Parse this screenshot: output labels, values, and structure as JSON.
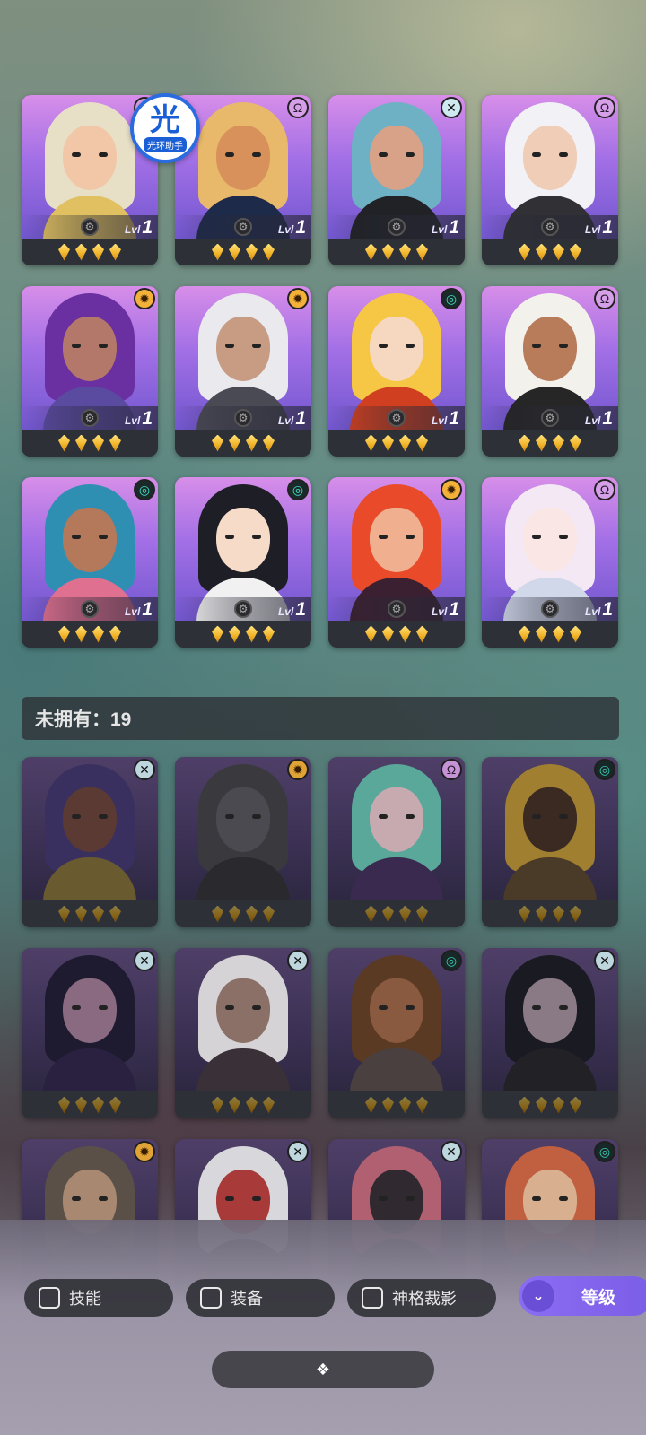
{
  "halo_badge": {
    "glyph": "光",
    "label": "光环助手"
  },
  "owned_heroes": [
    {
      "class_icon": "rose",
      "level_label": "Lvl",
      "level": "1",
      "stars": 4,
      "hair": "#e8dfc7",
      "skin": "#f1c7a8",
      "cloth": "#e0c060"
    },
    {
      "class_icon": "rose",
      "level_label": "Lvl",
      "level": "1",
      "stars": 4,
      "hair": "#e8b96a",
      "skin": "#d9915c",
      "cloth": "#1e2a4a"
    },
    {
      "class_icon": "cross",
      "level_label": "Lvl",
      "level": "1",
      "stars": 4,
      "hair": "#6fb1c4",
      "skin": "#d7a287",
      "cloth": "#202226"
    },
    {
      "class_icon": "rose",
      "level_label": "Lvl",
      "level": "1",
      "stars": 4,
      "hair": "#f1f1f6",
      "skin": "#efcdb7",
      "cloth": "#303035"
    },
    {
      "class_icon": "sun",
      "level_label": "Lvl",
      "level": "1",
      "stars": 4,
      "hair": "#6a2fa0",
      "skin": "#b4786a",
      "cloth": "#5a4aa0"
    },
    {
      "class_icon": "sun",
      "level_label": "Lvl",
      "level": "1",
      "stars": 4,
      "hair": "#e9e9ee",
      "skin": "#c79c83",
      "cloth": "#4a4a55"
    },
    {
      "class_icon": "swirl",
      "level_label": "Lvl",
      "level": "1",
      "stars": 4,
      "hair": "#f6c745",
      "skin": "#f6d8c0",
      "cloth": "#d04020"
    },
    {
      "class_icon": "rose",
      "level_label": "Lvl",
      "level": "1",
      "stars": 4,
      "hair": "#f3f1ec",
      "skin": "#b87c5a",
      "cloth": "#262626"
    },
    {
      "class_icon": "swirl",
      "level_label": "Lvl",
      "level": "1",
      "stars": 4,
      "hair": "#2f8fb2",
      "skin": "#b4785a",
      "cloth": "#e07090"
    },
    {
      "class_icon": "swirl",
      "level_label": "Lvl",
      "level": "1",
      "stars": 4,
      "hair": "#1e1e26",
      "skin": "#f6dcc8",
      "cloth": "#f1f1f1"
    },
    {
      "class_icon": "sun",
      "level_label": "Lvl",
      "level": "1",
      "stars": 4,
      "hair": "#e84a2a",
      "skin": "#f0b090",
      "cloth": "#3a2030"
    },
    {
      "class_icon": "rose",
      "level_label": "Lvl",
      "level": "1",
      "stars": 4,
      "hair": "#f3e8f4",
      "skin": "#fbe6e6",
      "cloth": "#d0d8ea"
    }
  ],
  "unowned_section": {
    "label": "未拥有：19"
  },
  "unowned_heroes": [
    {
      "class_icon": "cross",
      "stars": 4,
      "hair": "#3a3060",
      "skin": "#5a3a32",
      "cloth": "#6a5a30"
    },
    {
      "class_icon": "sun",
      "stars": 4,
      "hair": "#3a3a3e",
      "skin": "#4a4a50",
      "cloth": "#2a2a2e"
    },
    {
      "class_icon": "rose",
      "stars": 4,
      "hair": "#5aa89a",
      "skin": "#c7a9b0",
      "cloth": "#3a2a50"
    },
    {
      "class_icon": "swirl",
      "stars": 4,
      "hair": "#a08030",
      "skin": "#3a2a22",
      "cloth": "#4a3a28"
    },
    {
      "class_icon": "cross",
      "stars": 4,
      "hair": "#1e1a30",
      "skin": "#8a6a80",
      "cloth": "#2a2040"
    },
    {
      "class_icon": "cross",
      "stars": 4,
      "hair": "#d6d3d6",
      "skin": "#8a7066",
      "cloth": "#3a3038"
    },
    {
      "class_icon": "swirl",
      "stars": 4,
      "hair": "#5a3a22",
      "skin": "#8a5a40",
      "cloth": "#4a4040"
    },
    {
      "class_icon": "cross",
      "stars": 4,
      "hair": "#1a1a22",
      "skin": "#8a7a86",
      "cloth": "#222226"
    },
    {
      "class_icon": "sun",
      "stars": 4,
      "hair": "#5a5048",
      "skin": "#a88870",
      "cloth": "#3a3a40"
    },
    {
      "class_icon": "cross",
      "stars": 4,
      "hair": "#d8d8dc",
      "skin": "#a83a3a",
      "cloth": "#222"
    },
    {
      "class_icon": "cross",
      "stars": 4,
      "hair": "#b06070",
      "skin": "#302a30",
      "cloth": "#1a1a1e"
    },
    {
      "class_icon": "swirl",
      "stars": 4,
      "hair": "#c06040",
      "skin": "#d8b090",
      "cloth": "#4a4a60"
    }
  ],
  "filters": [
    {
      "label": "技能",
      "checked": false
    },
    {
      "label": "装备",
      "checked": false
    },
    {
      "label": "神格裁影",
      "checked": false
    }
  ],
  "sort_button": {
    "label": "等级",
    "icon": "double-chevron-down-icon"
  },
  "bottom_handle": {
    "icon": "diamond-cluster-icon"
  },
  "class_icon_glyphs": {
    "rose": "Ω",
    "cross": "✕",
    "sun": "✹",
    "swirl": "◎"
  },
  "colors": {
    "accent": "#8b6df2",
    "star": "#f2b52a",
    "card_bg": "#2e3038"
  }
}
